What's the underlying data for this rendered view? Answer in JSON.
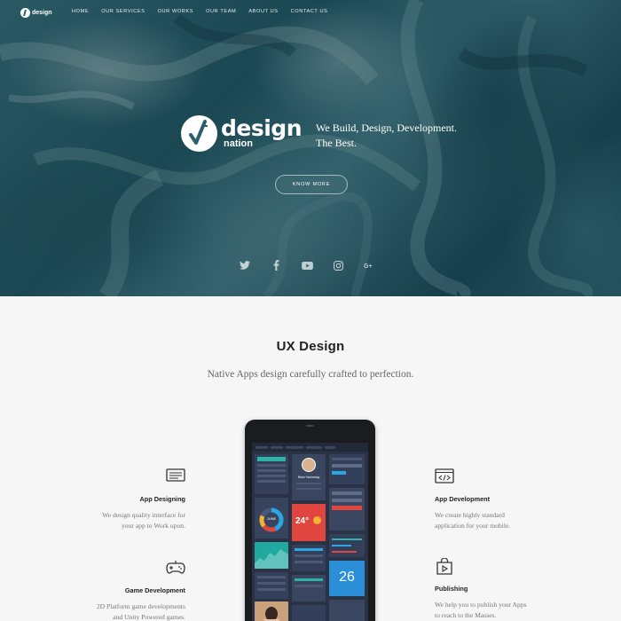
{
  "nav": {
    "logo_text": "design",
    "links": [
      "HOME",
      "OUR SERVICES",
      "OUR WORKS",
      "OUR TEAM",
      "ABOUT US",
      "CONTACT US"
    ]
  },
  "hero": {
    "brand_word": "design",
    "brand_sub": "nation",
    "tagline_line1": "We Build, Design, Development.",
    "tagline_line2": "The Best.",
    "cta_label": "KNOW MORE",
    "social_icons": [
      "twitter-icon",
      "facebook-icon",
      "youtube-icon",
      "instagram-icon",
      "google-plus-icon"
    ]
  },
  "section": {
    "title": "UX Design",
    "subtitle": "Native Apps design carefully crafted to perfection."
  },
  "features": {
    "app_designing": {
      "title": "App Designing",
      "line1": "We design quality interface for",
      "line2": "your app to Work upon.",
      "icon": "monitor-icon"
    },
    "game_development": {
      "title": "Game Development",
      "line1": "2D Platform game developments",
      "line2": "and Unity Powered games.",
      "icon": "gamepad-icon"
    },
    "app_development": {
      "title": "App Development",
      "line1": "We create highly standard",
      "line2": "application for your mobile.",
      "icon": "code-window-icon"
    },
    "publishing": {
      "title": "Publishing",
      "line1": "We help you to publish your Apps",
      "line2": "to reach to the Masses.",
      "icon": "play-bag-icon"
    }
  },
  "phone_screen": {
    "weather_temp": "24°",
    "calendar_day": "26",
    "profile_name": "Brian Yachamay",
    "chart_label": "JUNE"
  },
  "colors": {
    "hero_teal": "#245b68",
    "background": "#f6f6f6",
    "accent_red": "#e0463f",
    "accent_blue": "#2a8fd6"
  }
}
